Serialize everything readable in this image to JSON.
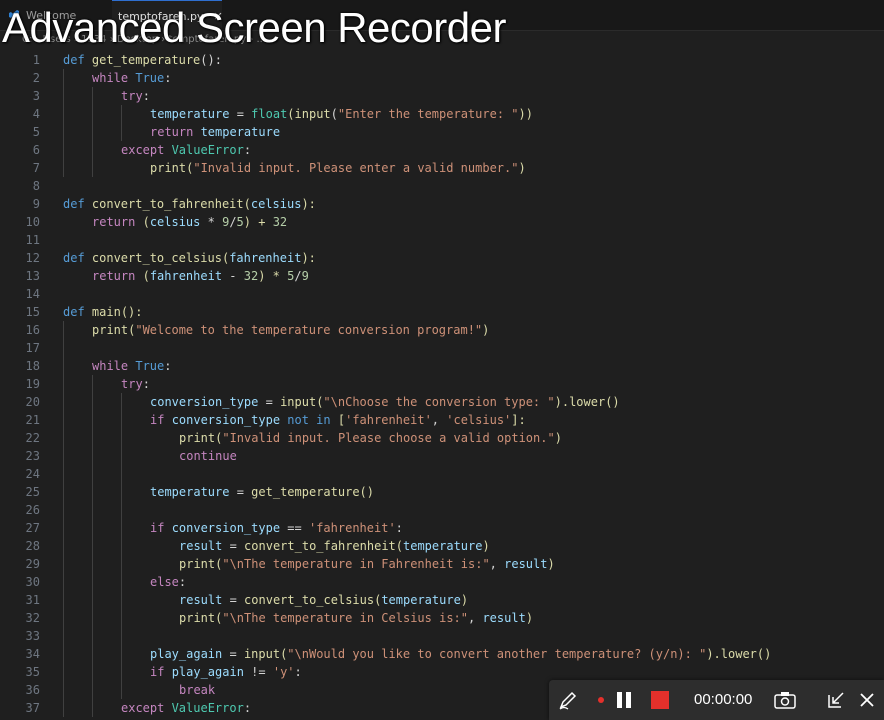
{
  "tabs": [
    {
      "label": "Welcome",
      "active": false
    },
    {
      "label": "temptofaren.py",
      "active": true
    }
  ],
  "breadcrumb": "C: › Users › 1934 › Desktop › temptofaren.py › ...",
  "overlay_title": "Advanced Screen Recorder",
  "line_numbers": [
    "1",
    "2",
    "3",
    "4",
    "5",
    "6",
    "7",
    "8",
    "9",
    "10",
    "11",
    "12",
    "13",
    "14",
    "15",
    "16",
    "17",
    "18",
    "19",
    "20",
    "21",
    "22",
    "23",
    "24",
    "25",
    "26",
    "27",
    "28",
    "29",
    "30",
    "31",
    "32",
    "33",
    "34",
    "35",
    "36",
    "37"
  ],
  "code": {
    "l1": {
      "def": "def ",
      "name": "get_temperature",
      "rest": "():"
    },
    "l2": {
      "kw": "while ",
      "val": "True",
      "rest": ":"
    },
    "l3": {
      "kw": "try",
      "rest": ":"
    },
    "l4": {
      "var": "temperature",
      "eq": " = ",
      "fn": "float",
      "p1": "(",
      "fn2": "input",
      "p2": "(",
      "str": "\"Enter the temperature: \"",
      "rest": "))"
    },
    "l5": {
      "kw": "return ",
      "var": "temperature"
    },
    "l6": {
      "kw": "except ",
      "cls": "ValueError",
      "rest": ":"
    },
    "l7": {
      "fn": "print",
      "p1": "(",
      "str": "\"Invalid input. Please enter a valid number.\"",
      "rest": ")"
    },
    "l9": {
      "def": "def ",
      "name": "convert_to_fahrenheit",
      "p1": "(",
      "param": "celsius",
      "rest": "):"
    },
    "l10": {
      "kw": "return ",
      "p1": "(",
      "var": "celsius",
      "op": " * ",
      "n1": "9",
      "op2": "/",
      "n2": "5",
      "p2": ") + ",
      "n3": "32"
    },
    "l12": {
      "def": "def ",
      "name": "convert_to_celsius",
      "p1": "(",
      "param": "fahrenheit",
      "rest": "):"
    },
    "l13": {
      "kw": "return ",
      "p1": "(",
      "var": "fahrenheit",
      "op": " - ",
      "n1": "32",
      "p2": ") * ",
      "n2": "5",
      "op2": "/",
      "n3": "9"
    },
    "l15": {
      "def": "def ",
      "name": "main",
      "rest": "():"
    },
    "l16": {
      "fn": "print",
      "p1": "(",
      "str": "\"Welcome to the temperature conversion program!\"",
      "rest": ")"
    },
    "l18": {
      "kw": "while ",
      "val": "True",
      "rest": ":"
    },
    "l19": {
      "kw": "try",
      "rest": ":"
    },
    "l20": {
      "var": "conversion_type",
      "eq": " = ",
      "fn": "input",
      "p1": "(",
      "str": "\"\\nChoose the conversion type: \"",
      "p2": ").",
      "fn2": "lower",
      "rest": "()"
    },
    "l21": {
      "kw": "if ",
      "var": "conversion_type",
      "kw2": " not in ",
      "p1": "[",
      "s1": "'fahrenheit'",
      "c": ", ",
      "s2": "'celsius'",
      "rest": "]:"
    },
    "l22": {
      "fn": "print",
      "p1": "(",
      "str": "\"Invalid input. Please choose a valid option.\"",
      "rest": ")"
    },
    "l23": {
      "kw": "continue"
    },
    "l25": {
      "var": "temperature",
      "eq": " = ",
      "fn": "get_temperature",
      "rest": "()"
    },
    "l27": {
      "kw": "if ",
      "var": "conversion_type",
      "op": " == ",
      "str": "'fahrenheit'",
      "rest": ":"
    },
    "l28": {
      "var": "result",
      "eq": " = ",
      "fn": "convert_to_fahrenheit",
      "p1": "(",
      "arg": "temperature",
      "rest": ")"
    },
    "l29": {
      "fn": "print",
      "p1": "(",
      "str": "\"\\nThe temperature in Fahrenheit is:\"",
      "c": ", ",
      "arg": "result",
      "rest": ")"
    },
    "l30": {
      "kw": "else",
      "rest": ":"
    },
    "l31": {
      "var": "result",
      "eq": " = ",
      "fn": "convert_to_celsius",
      "p1": "(",
      "arg": "temperature",
      "rest": ")"
    },
    "l32": {
      "fn": "print",
      "p1": "(",
      "str": "\"\\nThe temperature in Celsius is:\"",
      "c": ", ",
      "arg": "result",
      "rest": ")"
    },
    "l34": {
      "var": "play_again",
      "eq": " = ",
      "fn": "input",
      "p1": "(",
      "str": "\"\\nWould you like to convert another temperature? (y/n): \"",
      "p2": ").",
      "fn2": "lower",
      "rest": "()"
    },
    "l35": {
      "kw": "if ",
      "var": "play_again",
      "op": " != ",
      "str": "'y'",
      "rest": ":"
    },
    "l36": {
      "kw": "break"
    },
    "l37": {
      "kw": "except ",
      "cls": "ValueError",
      "rest": ":"
    }
  },
  "recorder": {
    "time": "00:00:00",
    "icons": [
      "pen-icon",
      "record-dot-icon",
      "pause-icon",
      "stop-icon",
      "camera-icon",
      "minimize-icon",
      "close-icon"
    ],
    "stop_color": "#e5302b"
  }
}
